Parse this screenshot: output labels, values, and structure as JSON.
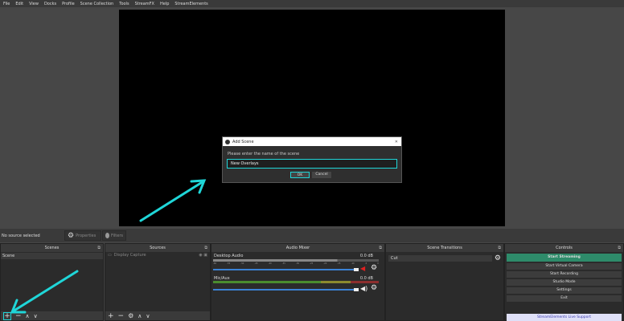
{
  "menu": [
    "File",
    "Edit",
    "View",
    "Docks",
    "Profile",
    "Scene Collection",
    "Tools",
    "StreamFX",
    "Help",
    "StreamElements"
  ],
  "dialog": {
    "title": "Add Scene",
    "prompt": "Please enter the name of the scene",
    "value": "New Overlays",
    "ok": "OK",
    "cancel": "Cancel",
    "close": "✕"
  },
  "context": {
    "status": "No source selected",
    "properties": "Properties",
    "filters": "Filters"
  },
  "scenes": {
    "title": "Scenes",
    "items": [
      "Scene"
    ]
  },
  "sources": {
    "title": "Sources",
    "items": [
      "Display Capture"
    ]
  },
  "mixer": {
    "title": "Audio Mixer",
    "channels": [
      {
        "name": "Desktop Audio",
        "db": "0.0 dB",
        "muted": true
      },
      {
        "name": "Mic/Aux",
        "db": "0.0 dB",
        "muted": false
      }
    ],
    "ticks": [
      "-60",
      "-55",
      "-50",
      "-45",
      "-40",
      "-35",
      "-30",
      "-25",
      "-20",
      "-15",
      "-10",
      "-5",
      "0"
    ]
  },
  "transitions": {
    "title": "Scene Transitions",
    "selected": "Cut"
  },
  "controls": {
    "title": "Controls",
    "buttons": [
      "Start Streaming",
      "Start Virtual Camera",
      "Start Recording",
      "Studio Mode",
      "Settings",
      "Exit"
    ],
    "support": "StreamElements Live Support"
  },
  "colors": {
    "accent": "#1fd6d8",
    "stream": "#2e8b6a"
  }
}
